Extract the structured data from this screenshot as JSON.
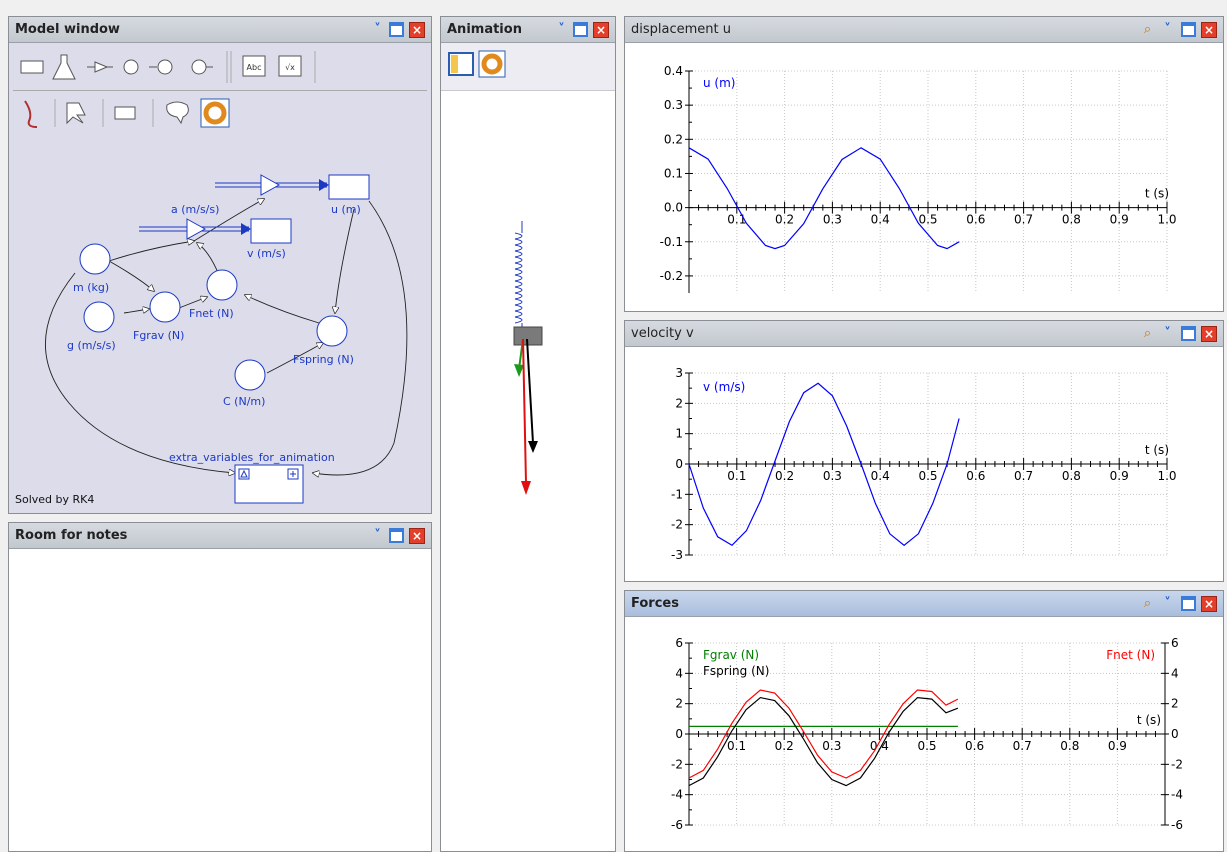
{
  "panels": {
    "model": {
      "title": "Model window",
      "status": "Solved by RK4"
    },
    "notes": {
      "title": "Room for notes"
    },
    "animation": {
      "title": "Animation"
    },
    "displacement": {
      "title": "displacement u"
    },
    "velocity": {
      "title": "velocity v"
    },
    "forces": {
      "title": "Forces"
    }
  },
  "icons": {
    "dropdown": "chevron-down-icon",
    "maximize": "maximize-icon",
    "close": "close-icon",
    "zoom": "magnifier-icon"
  },
  "model": {
    "nodes": {
      "a": "a (m/s/s)",
      "u": "u (m)",
      "v": "v (m/s)",
      "m": "m (kg)",
      "fnet": "Fnet (N)",
      "g": "g (m/s/s)",
      "fgrav": "Fgrav (N)",
      "fspring": "Fspring (N)",
      "c": "C (N/m)",
      "extra": "extra_variables_for_animation"
    }
  },
  "colors": {
    "curve": "#0000ff",
    "fgrav": "#008000",
    "fspring": "#000000",
    "fnet": "#ff0000",
    "model_bg": "#dcdceb",
    "node_stroke": "#1c39c4"
  },
  "chart_data": [
    {
      "type": "line",
      "title": "displacement u",
      "xlabel": "t (s)",
      "ylabel": "u (m)",
      "xlim": [
        0,
        1.0
      ],
      "ylim": [
        -0.25,
        0.4
      ],
      "xticks": [
        0.1,
        0.2,
        0.3,
        0.4,
        0.5,
        0.6,
        0.7,
        0.8,
        0.9,
        1.0
      ],
      "xticklabels": [
        "0.1",
        "0.2",
        "0.3",
        "0.4",
        "0.5",
        "0.6",
        "0.7",
        "0.8",
        "0.9",
        "1.0"
      ],
      "yticks": [
        -0.2,
        -0.1,
        0.0,
        0.1,
        0.2,
        0.3,
        0.4
      ],
      "yticklabels": [
        "-0.2",
        "-0.1",
        "0.0",
        "0.1",
        "0.2",
        "0.3",
        "0.4"
      ],
      "grid": true,
      "series": [
        {
          "name": "u (m)",
          "color": "#0000ff",
          "x": [
            0,
            0.04,
            0.08,
            0.12,
            0.16,
            0.18,
            0.2,
            0.24,
            0.28,
            0.32,
            0.36,
            0.4,
            0.44,
            0.48,
            0.52,
            0.54,
            0.565
          ],
          "y": [
            0.175,
            0.142,
            0.056,
            -0.046,
            -0.111,
            -0.12,
            -0.111,
            -0.047,
            0.055,
            0.141,
            0.175,
            0.142,
            0.056,
            -0.046,
            -0.111,
            -0.12,
            -0.1
          ]
        }
      ]
    },
    {
      "type": "line",
      "title": "velocity v",
      "xlabel": "t (s)",
      "ylabel": "v (m/s)",
      "xlim": [
        0,
        1.0
      ],
      "ylim": [
        -3,
        3
      ],
      "xticks": [
        0.1,
        0.2,
        0.3,
        0.4,
        0.5,
        0.6,
        0.7,
        0.8,
        0.9,
        1.0
      ],
      "xticklabels": [
        "0.1",
        "0.2",
        "0.3",
        "0.4",
        "0.5",
        "0.6",
        "0.7",
        "0.8",
        "0.9",
        "1.0"
      ],
      "yticks": [
        -3,
        -2,
        -1,
        0,
        1,
        2,
        3
      ],
      "yticklabels": [
        "-3",
        "-2",
        "-1",
        "0",
        "1",
        "2",
        "3"
      ],
      "grid": true,
      "series": [
        {
          "name": "v (m/s)",
          "color": "#0000ff",
          "x": [
            0,
            0.03,
            0.06,
            0.09,
            0.12,
            0.15,
            0.18,
            0.21,
            0.24,
            0.27,
            0.3,
            0.33,
            0.36,
            0.39,
            0.42,
            0.45,
            0.48,
            0.51,
            0.54,
            0.565
          ],
          "y": [
            0,
            -1.45,
            -2.4,
            -2.68,
            -2.2,
            -1.2,
            0.1,
            1.4,
            2.35,
            2.66,
            2.25,
            1.25,
            0.0,
            -1.3,
            -2.3,
            -2.68,
            -2.3,
            -1.3,
            0.0,
            1.5
          ]
        }
      ]
    },
    {
      "type": "line",
      "title": "Forces",
      "xlabel": "t (s)",
      "xlim": [
        0,
        1.0
      ],
      "ylim": [
        -6,
        6
      ],
      "xticks": [
        0.1,
        0.2,
        0.3,
        0.4,
        0.5,
        0.6,
        0.7,
        0.8,
        0.9
      ],
      "xticklabels": [
        "0.1",
        "0.2",
        "0.3",
        "0.4",
        "0.5",
        "0.6",
        "0.7",
        "0.8",
        "0.9"
      ],
      "yticks": [
        -6,
        -4,
        -2,
        0,
        2,
        4,
        6
      ],
      "yticklabels": [
        "-6",
        "-4",
        "-2",
        "0",
        "2",
        "4",
        "6"
      ],
      "y2ticklabels": [
        "-6",
        "-4",
        "-2",
        "0",
        "2",
        "4",
        "6"
      ],
      "grid": true,
      "legend": "top-left / top-right",
      "series": [
        {
          "name": "Fgrav (N)",
          "color": "#008000",
          "x": [
            0,
            0.565
          ],
          "y": [
            0.5,
            0.5
          ]
        },
        {
          "name": "Fspring (N)",
          "color": "#000000",
          "x": [
            0,
            0.03,
            0.06,
            0.09,
            0.12,
            0.15,
            0.18,
            0.21,
            0.24,
            0.27,
            0.3,
            0.33,
            0.36,
            0.39,
            0.42,
            0.45,
            0.48,
            0.51,
            0.54,
            0.565
          ],
          "y": [
            -3.4,
            -2.9,
            -1.5,
            0.2,
            1.6,
            2.4,
            2.2,
            1.2,
            -0.3,
            -1.9,
            -3.0,
            -3.4,
            -2.9,
            -1.6,
            0.1,
            1.5,
            2.4,
            2.3,
            1.4,
            1.7
          ]
        },
        {
          "name": "Fnet (N)",
          "color": "#ff0000",
          "x": [
            0,
            0.03,
            0.06,
            0.09,
            0.12,
            0.15,
            0.18,
            0.21,
            0.24,
            0.27,
            0.3,
            0.33,
            0.36,
            0.39,
            0.42,
            0.45,
            0.48,
            0.51,
            0.54,
            0.565
          ],
          "y": [
            -2.9,
            -2.4,
            -1.0,
            0.7,
            2.1,
            2.9,
            2.7,
            1.7,
            0.2,
            -1.4,
            -2.5,
            -2.9,
            -2.4,
            -1.1,
            0.6,
            2.0,
            2.9,
            2.8,
            1.9,
            2.3
          ]
        }
      ]
    }
  ]
}
